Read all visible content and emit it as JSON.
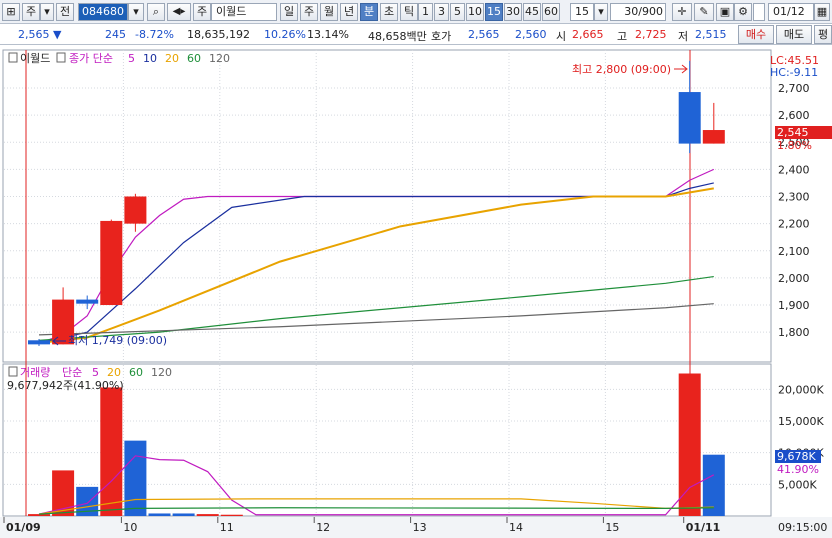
{
  "toolbar": {
    "market": "주",
    "prefix": "전",
    "code": "084680",
    "name": "이월드",
    "name_prefix": "주",
    "periods": [
      "일",
      "주",
      "월",
      "년",
      "분",
      "초",
      "틱"
    ],
    "active_period": "분",
    "intervals": [
      "1",
      "3",
      "5",
      "10",
      "15",
      "30",
      "45",
      "60"
    ],
    "active_interval": "15",
    "interval_select": "15",
    "count": "30",
    "count_total": "/900",
    "date": "01/12"
  },
  "quote": {
    "price": "2,565 ▼",
    "change": "245",
    "change_rate": "-8.72%",
    "volume": "18,635,192",
    "rate1": "10.26%",
    "rate2": "13.14%",
    "amount": "48,658백만",
    "hoga_label": "호가",
    "ask": "2,565",
    "bid": "2,560",
    "open_label": "시",
    "open": "2,665",
    "high_label": "고",
    "high": "2,725",
    "low_label": "저",
    "low": "2,515",
    "buy_button": "매수",
    "sell_button": "매도",
    "eval_button": "평"
  },
  "price_panel": {
    "title": "이월드",
    "ma_label": "종가 단순",
    "ma_periods": [
      "5",
      "10",
      "20",
      "60",
      "120"
    ],
    "ma_colors": [
      "#c01bc0",
      "#1a2f9e",
      "#e8a300",
      "#1f8f3a",
      "#666666"
    ],
    "high_annotation": "최고 2,800 (09:00)",
    "low_annotation": "최저 1,749 (09:00)",
    "lc": "LC:45.51",
    "hc": "HC:-9.11",
    "current_price": "2,545",
    "current_pct": "1.80%"
  },
  "volume_panel": {
    "title": "거래량",
    "ma_label": "단순",
    "ma_periods": [
      "5",
      "20",
      "60",
      "120"
    ],
    "ma_colors": [
      "#c01bc0",
      "#e8a300",
      "#1f8f3a",
      "#666666"
    ],
    "volume_text": "9,677,942주(41.90%)",
    "current_volume": "9,678K",
    "current_pct": "41.90%"
  },
  "x_axis": {
    "labels": [
      "01/09",
      "10",
      "11",
      "12",
      "13",
      "14",
      "15",
      "01/11"
    ],
    "time": "09:15:00"
  },
  "chart_data": [
    {
      "type": "candlestick",
      "title": "이월드",
      "y_ticks": [
        1800,
        1900,
        2000,
        2100,
        2200,
        2300,
        2400,
        2500,
        2600,
        2700
      ],
      "ylim": [
        1690,
        2840
      ],
      "candles": [
        {
          "x": 0,
          "open": 1770,
          "high": 1775,
          "low": 1749,
          "close": 1755
        },
        {
          "x": 1,
          "open": 1755,
          "high": 1965,
          "low": 1755,
          "close": 1920
        },
        {
          "x": 2,
          "open": 1920,
          "high": 1935,
          "low": 1885,
          "close": 1905
        },
        {
          "x": 3,
          "open": 1900,
          "high": 2215,
          "low": 1900,
          "close": 2210
        },
        {
          "x": 4,
          "open": 2200,
          "high": 2310,
          "low": 2170,
          "close": 2300
        },
        {
          "x": 27,
          "open": 2685,
          "high": 2800,
          "low": 2460,
          "close": 2495
        },
        {
          "x": 28,
          "open": 2495,
          "high": 2645,
          "low": 2495,
          "close": 2545
        }
      ],
      "moving_averages": [
        {
          "name": "5",
          "values": [
            [
              0,
              1760
            ],
            [
              1,
              1790
            ],
            [
              2,
              1860
            ],
            [
              3,
              2020
            ],
            [
              4,
              2150
            ],
            [
              5,
              2230
            ],
            [
              6,
              2290
            ],
            [
              7,
              2300
            ],
            [
              26,
              2300
            ],
            [
              27,
              2360
            ],
            [
              28,
              2400
            ]
          ]
        },
        {
          "name": "10",
          "values": [
            [
              0,
              1760
            ],
            [
              2,
              1800
            ],
            [
              4,
              1960
            ],
            [
              6,
              2130
            ],
            [
              8,
              2260
            ],
            [
              11,
              2300
            ],
            [
              26,
              2300
            ],
            [
              27,
              2330
            ],
            [
              28,
              2350
            ]
          ]
        },
        {
          "name": "20",
          "values": [
            [
              0,
              1760
            ],
            [
              2,
              1780
            ],
            [
              5,
              1880
            ],
            [
              10,
              2060
            ],
            [
              15,
              2190
            ],
            [
              20,
              2270
            ],
            [
              23,
              2300
            ],
            [
              26,
              2300
            ],
            [
              28,
              2330
            ]
          ]
        },
        {
          "name": "60",
          "values": [
            [
              0,
              1770
            ],
            [
              5,
              1800
            ],
            [
              10,
              1850
            ],
            [
              15,
              1890
            ],
            [
              20,
              1930
            ],
            [
              26,
              1980
            ],
            [
              28,
              2005
            ]
          ]
        },
        {
          "name": "120",
          "values": [
            [
              0,
              1790
            ],
            [
              5,
              1805
            ],
            [
              10,
              1820
            ],
            [
              15,
              1840
            ],
            [
              20,
              1860
            ],
            [
              26,
              1890
            ],
            [
              28,
              1905
            ]
          ]
        }
      ]
    },
    {
      "type": "bar",
      "title": "거래량",
      "y_ticks": [
        5000,
        10000,
        15000,
        20000
      ],
      "ylim": [
        0,
        24000
      ],
      "bars": [
        {
          "x": 0,
          "value": 300,
          "color": "red"
        },
        {
          "x": 1,
          "value": 7200,
          "color": "red"
        },
        {
          "x": 2,
          "value": 4600,
          "color": "blue"
        },
        {
          "x": 3,
          "value": 20300,
          "color": "red"
        },
        {
          "x": 4,
          "value": 11900,
          "color": "blue"
        },
        {
          "x": 5,
          "value": 400,
          "color": "blue"
        },
        {
          "x": 6,
          "value": 400,
          "color": "blue"
        },
        {
          "x": 7,
          "value": 300,
          "color": "red"
        },
        {
          "x": 8,
          "value": 200,
          "color": "red"
        },
        {
          "x": 27,
          "value": 22500,
          "color": "red"
        },
        {
          "x": 28,
          "value": 9678,
          "color": "blue"
        }
      ],
      "moving_averages": [
        {
          "name": "5",
          "values": [
            [
              0,
              300
            ],
            [
              2,
              2000
            ],
            [
              3,
              5500
            ],
            [
              4,
              9500
            ],
            [
              5,
              8900
            ],
            [
              6,
              8800
            ],
            [
              7,
              7000
            ],
            [
              8,
              2500
            ],
            [
              9,
              200
            ],
            [
              26,
              200
            ],
            [
              27,
              4500
            ],
            [
              28,
              6500
            ]
          ]
        },
        {
          "name": "20",
          "values": [
            [
              0,
              300
            ],
            [
              4,
              2600
            ],
            [
              9,
              2700
            ],
            [
              20,
              2700
            ],
            [
              23,
              2000
            ],
            [
              26,
              1200
            ],
            [
              28,
              1400
            ]
          ]
        },
        {
          "name": "60",
          "values": [
            [
              0,
              300
            ],
            [
              4,
              1200
            ],
            [
              10,
              1300
            ],
            [
              26,
              1200
            ],
            [
              28,
              1300
            ]
          ]
        }
      ]
    }
  ]
}
